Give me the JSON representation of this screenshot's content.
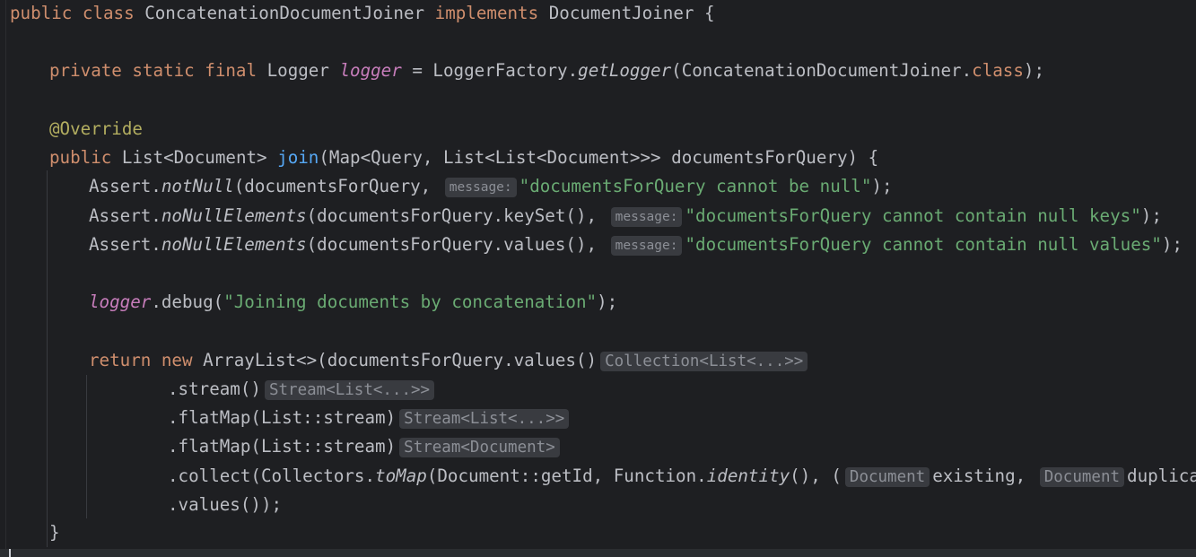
{
  "editor": {
    "language": "Java",
    "theme": {
      "background": "#1e1f22",
      "keyword": "#cf8e6d",
      "field": "#c77dbb",
      "method_decl": "#56a8f5",
      "string": "#6aab73",
      "annotation": "#b3ae60",
      "hint_bg": "#393b40"
    },
    "code": {
      "l1": {
        "a": "public class ",
        "b": "ConcatenationDocumentJoiner ",
        "c": "implements ",
        "d": "DocumentJoiner {"
      },
      "l2": {
        "a": "private static final ",
        "b": "Logger ",
        "c": "logger",
        "d": " = LoggerFactory.",
        "e": "getLogger",
        "f": "(ConcatenationDocumentJoiner.",
        "g": "class",
        "h": ");"
      },
      "l3": {
        "a": "@Override"
      },
      "l4": {
        "a": "public ",
        "b": "List<Document> ",
        "c": "join",
        "d": "(Map<Query, List<List<Document>>> documentsForQuery) {"
      },
      "l5": {
        "a": "Assert.",
        "b": "notNull",
        "c": "(documentsForQuery, ",
        "hint": "message:",
        "d": "\"documentsForQuery cannot be null\"",
        "e": ");"
      },
      "l6": {
        "a": "Assert.",
        "b": "noNullElements",
        "c": "(documentsForQuery.keySet(), ",
        "hint": "message:",
        "d": "\"documentsForQuery cannot contain null keys\"",
        "e": ");"
      },
      "l7": {
        "a": "Assert.",
        "b": "noNullElements",
        "c": "(documentsForQuery.values(), ",
        "hint": "message:",
        "d": "\"documentsForQuery cannot contain null values\"",
        "e": ");"
      },
      "l8": {
        "a": "logger",
        "b": ".debug(",
        "c": "\"Joining documents by concatenation\"",
        "d": ");"
      },
      "l9": {
        "a": "return new ",
        "b": "ArrayList<>(documentsForQuery.values()",
        "hint": "Collection<List<...>>"
      },
      "l10": {
        "a": ".stream()",
        "hint": "Stream<List<...>>"
      },
      "l11": {
        "a": ".flatMap(List::stream)",
        "hint": "Stream<List<...>>"
      },
      "l12": {
        "a": ".flatMap(List::stream)",
        "hint": "Stream<Document>"
      },
      "l13": {
        "a": ".collect(Collectors.",
        "b": "toMap",
        "c": "(Document::getId, Function.",
        "d": "identity",
        "e": "(), (",
        "hint1": "Document",
        "f": "existing, ",
        "hint2": "Document",
        "g": "duplicate)"
      },
      "l14": {
        "a": ".values());"
      },
      "l15": {
        "a": "}"
      }
    }
  }
}
